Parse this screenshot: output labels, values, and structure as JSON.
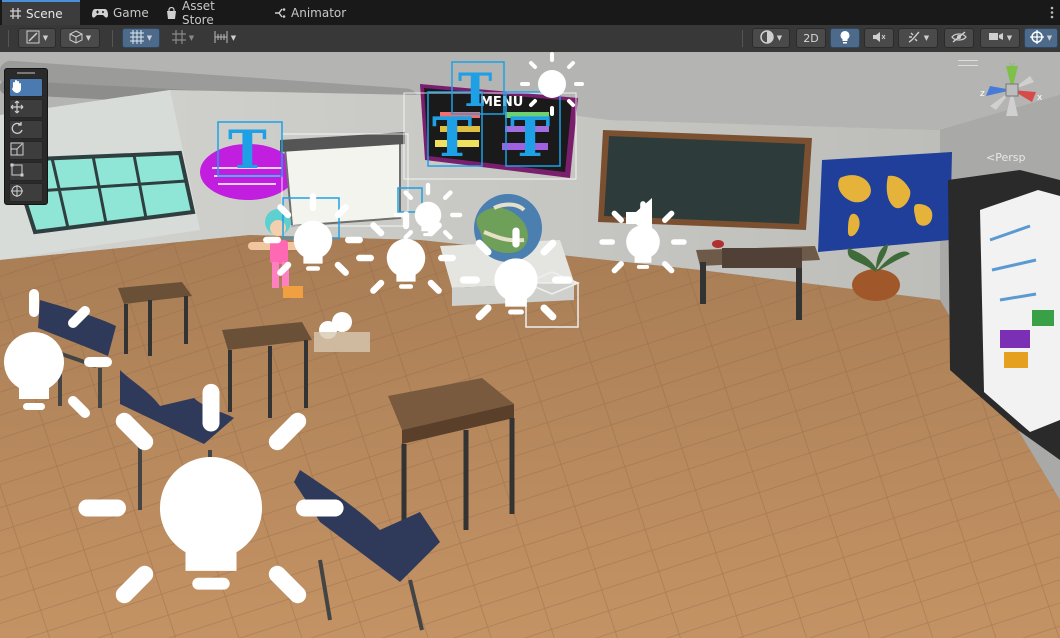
{
  "tabs": [
    {
      "label": "Scene",
      "icon": "grid-icon",
      "active": true
    },
    {
      "label": "Game",
      "icon": "gamepad-icon",
      "active": false
    },
    {
      "label": "Asset Store",
      "icon": "shopping-bag-icon",
      "active": false
    },
    {
      "label": "Animator",
      "icon": "animator-icon",
      "active": false
    }
  ],
  "toolbar": {
    "mode_2d_label": "2D",
    "left_tools": [
      "draw-mode-icon",
      "shading-icon",
      "snap-icon",
      "grid-snap-icon",
      "increment-snap-icon"
    ],
    "right_tools": [
      "render-mode-icon",
      "lighting-icon",
      "audio-icon",
      "effects-icon",
      "hidden-visibility-icon",
      "camera-icon",
      "gizmos-icon"
    ]
  },
  "scene_tools": [
    "hand-tool-icon",
    "move-tool-icon",
    "rotate-tool-icon",
    "scale-tool-icon",
    "rect-tool-icon",
    "transform-tool-icon"
  ],
  "gizmo": {
    "axis_y": "y",
    "axis_z": "z",
    "axis_x": "x",
    "projection_label": "Persp"
  },
  "scene_board": {
    "title": "MENU"
  },
  "colors": {
    "accent": "#4a90d9",
    "selection_blue": "#1ea0e6",
    "floor": "#b98a5a",
    "wall": "#c8c8c4"
  }
}
